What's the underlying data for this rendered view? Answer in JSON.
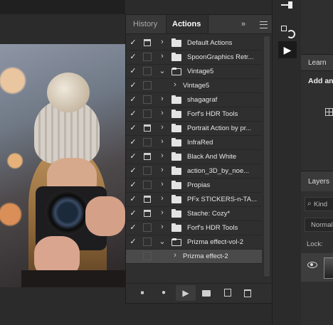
{
  "panel": {
    "tabs": [
      {
        "label": "History",
        "active": false
      },
      {
        "label": "Actions",
        "active": true
      }
    ],
    "expand_glyph": "»",
    "rows": [
      {
        "label": "Default Actions",
        "checked": true,
        "dialog": true,
        "kind": "set",
        "open": false,
        "selected": false
      },
      {
        "label": "SpoonGraphics Retr...",
        "checked": true,
        "dialog": false,
        "kind": "set",
        "open": false,
        "selected": false
      },
      {
        "label": "Vintage5",
        "checked": true,
        "dialog": false,
        "kind": "set",
        "open": true,
        "selected": false
      },
      {
        "label": "Vintage5",
        "checked": true,
        "dialog": false,
        "kind": "action",
        "open": false,
        "selected": false
      },
      {
        "label": "shagagraf",
        "checked": true,
        "dialog": false,
        "kind": "set",
        "open": false,
        "selected": false
      },
      {
        "label": "Forf's HDR Tools",
        "checked": true,
        "dialog": false,
        "kind": "set",
        "open": false,
        "selected": false
      },
      {
        "label": "Portrait Action by pr...",
        "checked": true,
        "dialog": true,
        "kind": "set",
        "open": false,
        "selected": false
      },
      {
        "label": "InfraRed",
        "checked": true,
        "dialog": false,
        "kind": "set",
        "open": false,
        "selected": false
      },
      {
        "label": "Black And White",
        "checked": true,
        "dialog": true,
        "kind": "set",
        "open": false,
        "selected": false
      },
      {
        "label": "action_3D_by_noe...",
        "checked": true,
        "dialog": false,
        "kind": "set",
        "open": false,
        "selected": false
      },
      {
        "label": "Propias",
        "checked": true,
        "dialog": false,
        "kind": "set",
        "open": false,
        "selected": false
      },
      {
        "label": "PFx STICKERS-n-TA...",
        "checked": true,
        "dialog": true,
        "kind": "set",
        "open": false,
        "selected": false
      },
      {
        "label": "Stache: Cozy*",
        "checked": true,
        "dialog": true,
        "kind": "set",
        "open": false,
        "selected": false
      },
      {
        "label": "Forf's HDR Tools",
        "checked": true,
        "dialog": false,
        "kind": "set",
        "open": false,
        "selected": false
      },
      {
        "label": "Prizma effect-vol-2",
        "checked": true,
        "dialog": false,
        "kind": "set",
        "open": true,
        "selected": false
      },
      {
        "label": "Prizma effect-2",
        "checked": false,
        "dialog": false,
        "kind": "action",
        "open": false,
        "selected": true
      }
    ],
    "bottom_icons": [
      "stop-icon",
      "record-icon",
      "play-icon",
      "new-set-icon",
      "new-action-icon",
      "trash-icon"
    ]
  },
  "right_panels": {
    "learn_tab": "Learn",
    "learn_title": "Add an",
    "layers_tab": "Layers",
    "kind_placeholder": "Kind",
    "blend_mode": "Normal",
    "lock_label": "Lock:"
  },
  "icons": {
    "check": "✓",
    "chevron_right": "›",
    "chevron_down": "⌄",
    "play": "▶",
    "stop": "■",
    "record": "●",
    "trash": "🗑",
    "eye": "👁",
    "search": "⌕"
  }
}
